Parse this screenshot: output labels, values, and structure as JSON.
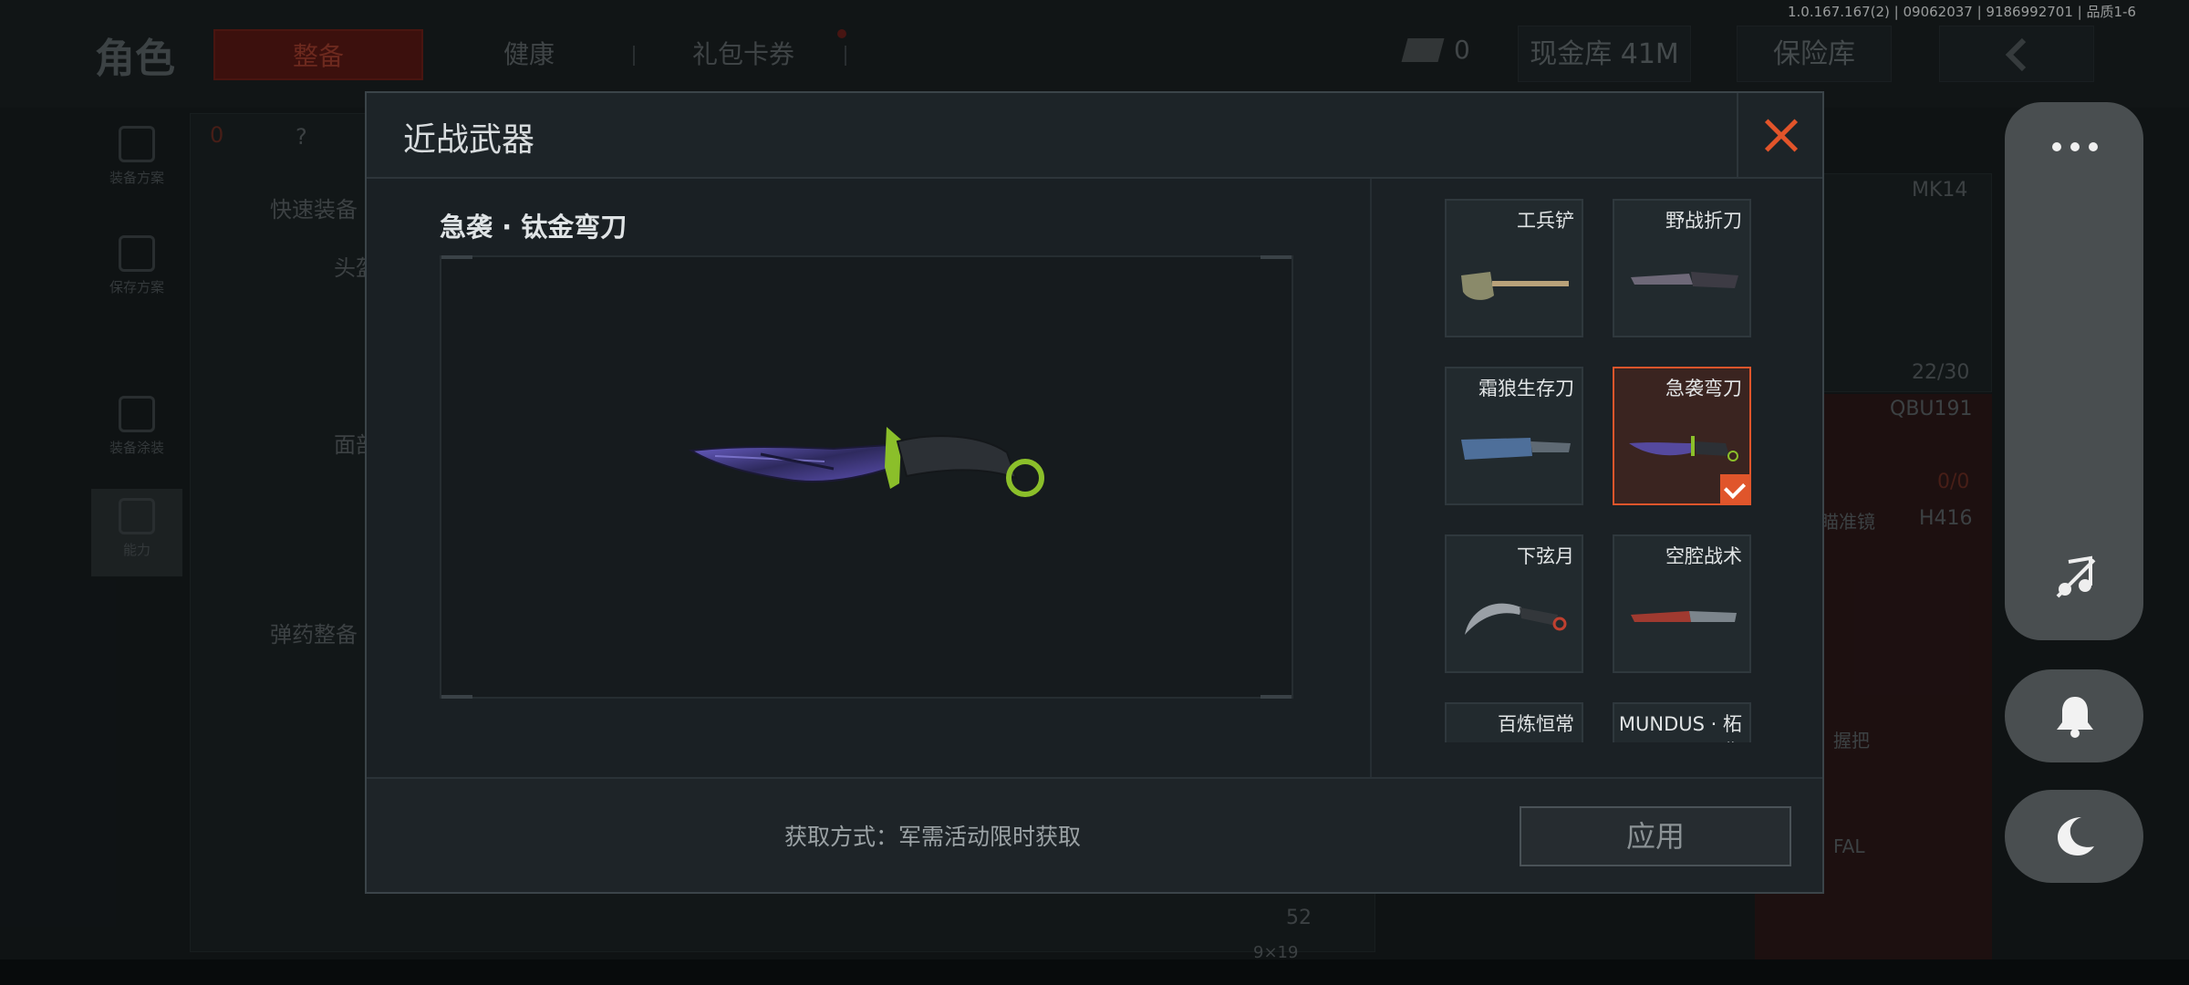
{
  "version_text": "1.0.167.167(2) | 09062037 | 9186992701 | 品质1-6",
  "background": {
    "title": "角色",
    "tabs": [
      {
        "label": "整备",
        "active": true
      },
      {
        "label": "健康",
        "active": false
      },
      {
        "label": "礼包卡券",
        "active": false
      }
    ],
    "cash_count": "0",
    "warehouse_button": "现金库 41M",
    "insurance_button": "保险库",
    "sidebar": [
      {
        "label": "装备方案"
      },
      {
        "label": "保存方案"
      },
      {
        "label": "装备涂装"
      },
      {
        "label": "能力"
      }
    ],
    "status_count": "0",
    "help_label": "?",
    "quick_equip": "快速装备",
    "ammo_equip": "弹药整备",
    "slot_head": "头盔",
    "slot_face": "面部",
    "weapon1": "MK14",
    "weapon1_ammo": "22/30",
    "weapon2": "QBU191",
    "weapon2_ammo": "0/0",
    "weapon3": "H416",
    "attachment_scope": "瞄准镜",
    "attachment_grip": "握把",
    "attachment_extra": "FAL",
    "ammo_count": "52",
    "ammo_type": "9×19"
  },
  "modal": {
    "title": "近战武器",
    "selected_name": "急袭 · 钛金弯刀",
    "items": [
      {
        "name": "工兵铲",
        "selected": false,
        "icon": "shovel-icon"
      },
      {
        "name": "野战折刀",
        "selected": false,
        "icon": "field-knife-icon"
      },
      {
        "name": "霜狼生存刀",
        "selected": false,
        "icon": "survival-knife-icon"
      },
      {
        "name": "急袭弯刀",
        "selected": true,
        "icon": "curved-knife-icon"
      },
      {
        "name": "下弦月",
        "selected": false,
        "icon": "karambit-icon"
      },
      {
        "name": "空腔战术",
        "selected": false,
        "icon": "tactical-knife-icon"
      },
      {
        "name": "百炼恒常",
        "selected": false,
        "icon": "blade-icon"
      },
      {
        "name": "MUNDUS · 柘伤",
        "selected": false,
        "icon": "blade-icon"
      }
    ],
    "source_text": "获取方式：军需活动限时获取",
    "apply_label": "应用"
  },
  "colors": {
    "accent": "#e0552b",
    "selected_bg": "#3a2420",
    "knife_purple": "#4a3f8e",
    "knife_green": "#8bbf2a"
  }
}
